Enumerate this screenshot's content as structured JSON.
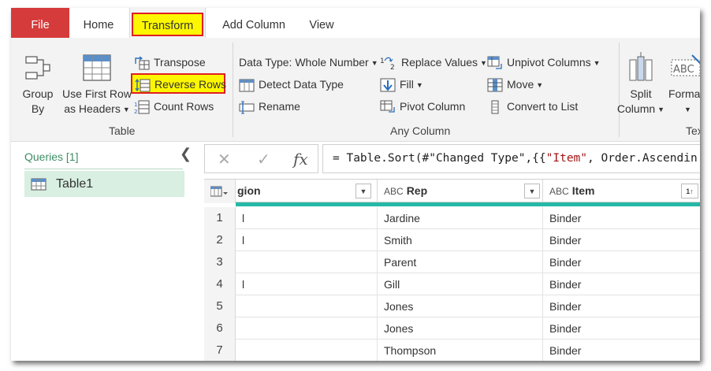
{
  "tabs": {
    "file": "File",
    "home": "Home",
    "transform": "Transform",
    "add_column": "Add Column",
    "view": "View"
  },
  "ribbon": {
    "table_group": {
      "label": "Table",
      "group_by_line1": "Group",
      "group_by_line2": "By",
      "use_first_row_line1": "Use First Row",
      "use_first_row_line2": "as Headers",
      "transpose": "Transpose",
      "reverse_rows": "Reverse Rows",
      "count_rows": "Count Rows"
    },
    "any_column_group": {
      "label": "Any Column",
      "data_type": "Data Type: Whole Number",
      "detect_data_type": "Detect Data Type",
      "rename": "Rename",
      "replace_values": "Replace Values",
      "fill": "Fill",
      "pivot_column": "Pivot Column",
      "unpivot_columns": "Unpivot Columns",
      "move": "Move",
      "convert_to_list": "Convert to List"
    },
    "text_group": {
      "label": "Tex",
      "split_line1": "Split",
      "split_line2": "Column",
      "format_line1": "Forma"
    }
  },
  "queries": {
    "title": "Queries [1]",
    "items": [
      {
        "label": "Table1"
      }
    ]
  },
  "formula_bar": {
    "cancel_glyph": "✕",
    "confirm_glyph": "✓",
    "fx_glyph": "fx",
    "prefix": "= Table.Sort(#\"Changed Type\",{{",
    "string_part": "\"Item\"",
    "suffix": ", Order.Ascendin"
  },
  "grid": {
    "columns": [
      {
        "name": "gion",
        "type": ""
      },
      {
        "name": "Rep",
        "type": "ABC"
      },
      {
        "name": "Item",
        "type": "ABC"
      }
    ],
    "item_sort_indicator": "1↑",
    "rows": [
      {
        "num": "1",
        "region": "l",
        "rep": "Jardine",
        "item": "Binder"
      },
      {
        "num": "2",
        "region": "l",
        "rep": "Smith",
        "item": "Binder"
      },
      {
        "num": "3",
        "region": "",
        "rep": "Parent",
        "item": "Binder"
      },
      {
        "num": "4",
        "region": "l",
        "rep": "Gill",
        "item": "Binder"
      },
      {
        "num": "5",
        "region": "",
        "rep": "Jones",
        "item": "Binder"
      },
      {
        "num": "6",
        "region": "",
        "rep": "Jones",
        "item": "Binder"
      },
      {
        "num": "7",
        "region": "",
        "rep": "Thompson",
        "item": "Binder"
      }
    ]
  },
  "colors": {
    "file_tab": "#d63b3b",
    "highlight_yellow": "#fcf700",
    "highlight_border": "#e02020",
    "queries_green": "#3f8d66",
    "selected_query_bg": "#d8efe2",
    "column_quality_teal": "#26b8a6"
  }
}
